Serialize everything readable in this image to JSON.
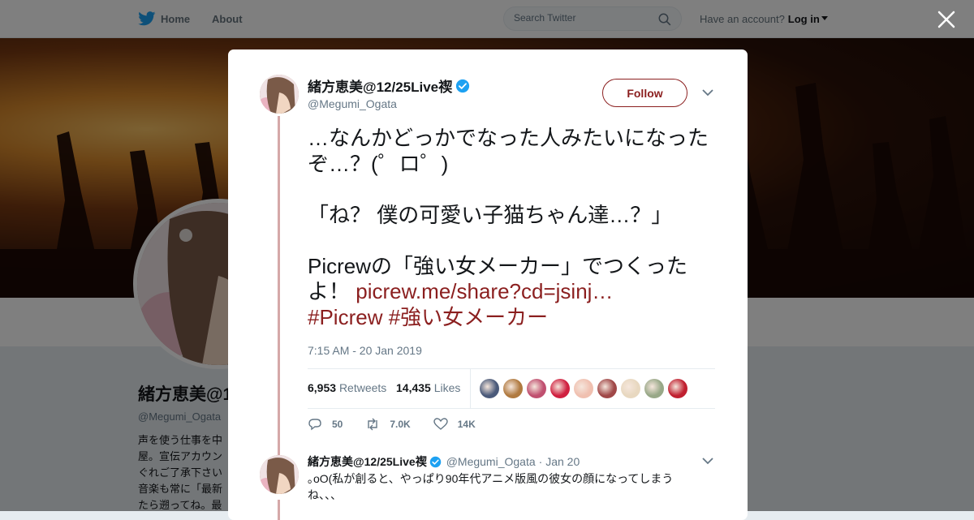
{
  "nav": {
    "home_label": "Home",
    "about_label": "About",
    "search_placeholder": "Search Twitter",
    "account_prompt": "Have an account?",
    "login_label": "Log in"
  },
  "background_profile": {
    "name": "緒方恵美@1",
    "handle": "@Megumi_Ogata",
    "bio": "声を使う仕事を中\n屋。宣伝アカウン\nぐれご了承下さい\n音楽も常に「最新\nたら遡ってね。最"
  },
  "tweet": {
    "author_name": "緒方恵美@12/25Live禊",
    "author_handle": "@Megumi_Ogata",
    "follow_label": "Follow",
    "text_main": "…なんかどっかでなった人みたいになったぞ…？(゜ロ゜)\n\n「ね？ 僕の可愛い子猫ちゃん達…？」\n\nPicrewの「強い女メーカー」でつくったよ！ ",
    "link": "picrew.me/share?cd=jsinj…",
    "hashtags": "#Picrew #強い女メーカー",
    "timestamp": "7:15 AM - 20 Jan 2019",
    "retweets_count": "6,953",
    "retweets_label": "Retweets",
    "likes_count": "14,435",
    "likes_label": "Likes",
    "liker_colors": [
      "#4a5a7a",
      "#b07a40",
      "#c05070",
      "#d02040",
      "#f0c0b0",
      "#a04848",
      "#e8d8c0",
      "#98a888",
      "#c02030"
    ],
    "actions": {
      "replies": "50",
      "retweets": "7.0K",
      "likes": "14K"
    }
  },
  "reply": {
    "author_name": "緒方恵美@12/25Live禊",
    "author_handle": "@Megumi_Ogata",
    "date": "· Jan 20",
    "text": "｡oO(私が創ると、やっぱり90年代アニメ版風の彼女の顔になってしまうね、、、"
  },
  "colors": {
    "accent": "#8b1f1f",
    "twitter_blue": "#1da1f2"
  }
}
